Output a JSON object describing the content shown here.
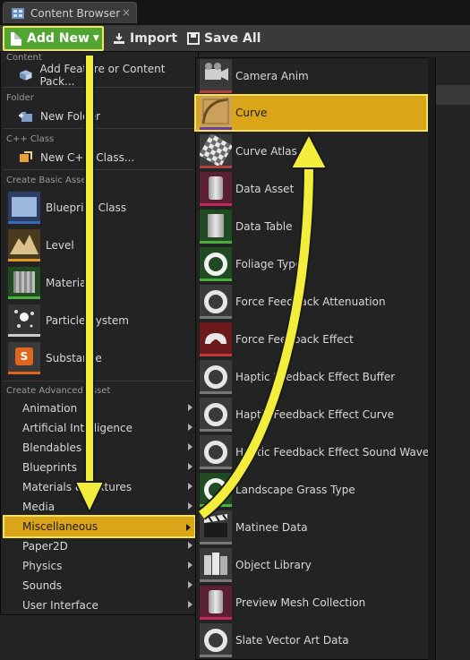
{
  "tab": {
    "label": "Content Browser",
    "close": "×"
  },
  "toolbar": {
    "add_new": "Add New",
    "import": "Import",
    "save_all": "Save All"
  },
  "left_menu": {
    "sections": {
      "content": "Content",
      "folder": "Folder",
      "cpp": "C++ Class",
      "basic": "Create Basic Asset",
      "advanced": "Create Advanced Asset"
    },
    "content_item": "Add Feature or Content Pack...",
    "folder_item": "New Folder",
    "cpp_item": "New C++ Class...",
    "basic_items": [
      "Blueprint Class",
      "Level",
      "Material",
      "Particle System",
      "Substance"
    ],
    "advanced_items": [
      "Animation",
      "Artificial Intelligence",
      "Blendables",
      "Blueprints",
      "Materials & Textures",
      "Media",
      "Miscellaneous",
      "Paper2D",
      "Physics",
      "Sounds",
      "User Interface"
    ],
    "selected": "Miscellaneous"
  },
  "right_menu": {
    "items": [
      "Camera Anim",
      "Curve",
      "Curve Atlas",
      "Data Asset",
      "Data Table",
      "Foliage Type",
      "Force Feedback Attenuation",
      "Force Feedback Effect",
      "Haptic Feedback Effect Buffer",
      "Haptic Feedback Effect Curve",
      "Haptic Feedback Effect Sound Wave",
      "Landscape Grass Type",
      "Matinee Data",
      "Object Library",
      "Preview Mesh Collection",
      "Slate Vector Art Data"
    ],
    "selected": "Curve"
  },
  "colors": {
    "accent_green": "#51a533",
    "highlight": "#dba51a",
    "outline_yellow": "#f3e45a"
  }
}
